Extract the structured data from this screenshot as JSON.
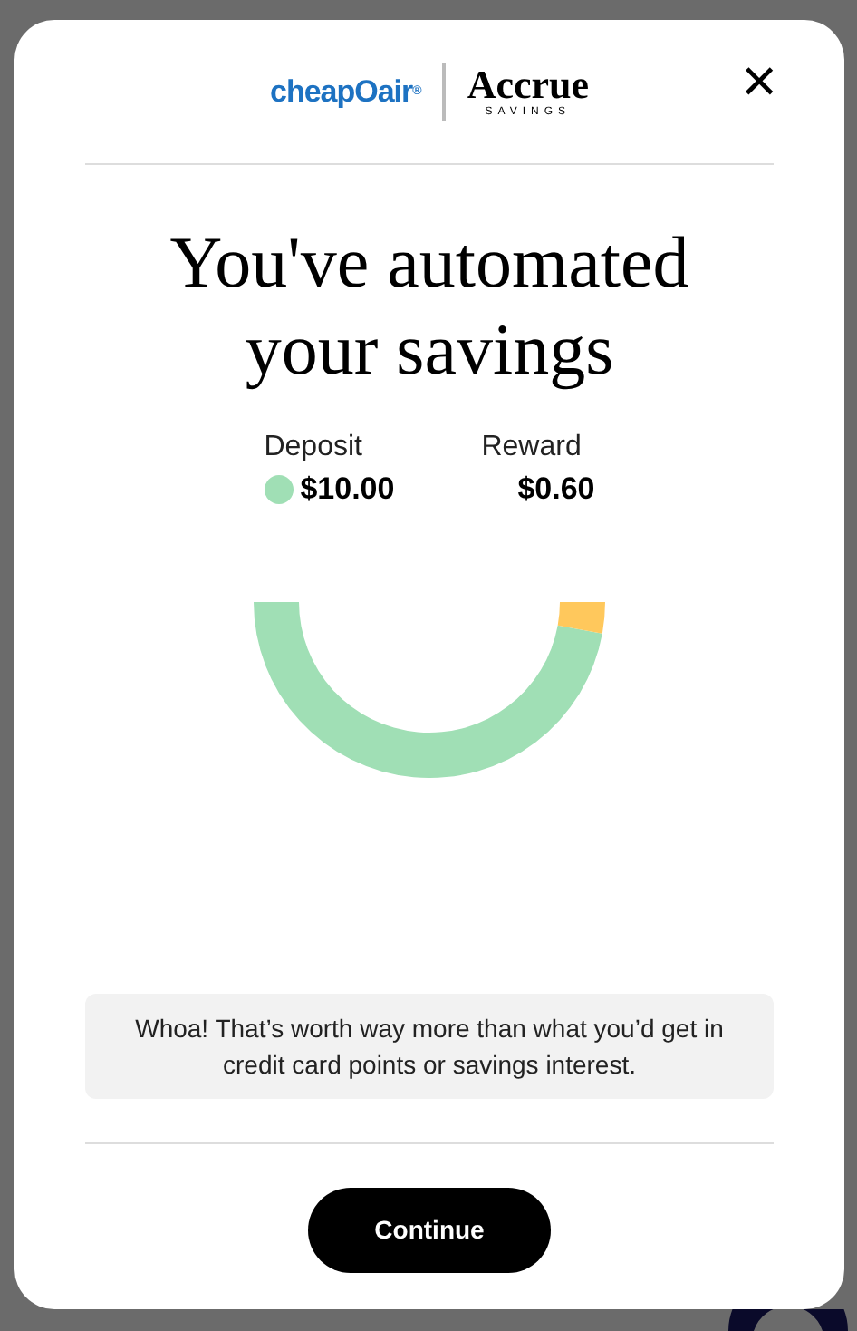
{
  "header": {
    "partner_logo": "cheapOair",
    "partner_mark": "®",
    "brand_logo": "Accrue",
    "brand_subtitle": "SAVINGS",
    "close": "×"
  },
  "title": "You've automated your savings",
  "legend": [
    {
      "label": "Deposit",
      "value": "$10.00",
      "color": "#a0dfb5"
    },
    {
      "label": "Reward",
      "value": "$0.60"
    }
  ],
  "message": "Whoa! That’s worth way more than what you’d get in credit card points or savings interest.",
  "button": "Continue"
}
